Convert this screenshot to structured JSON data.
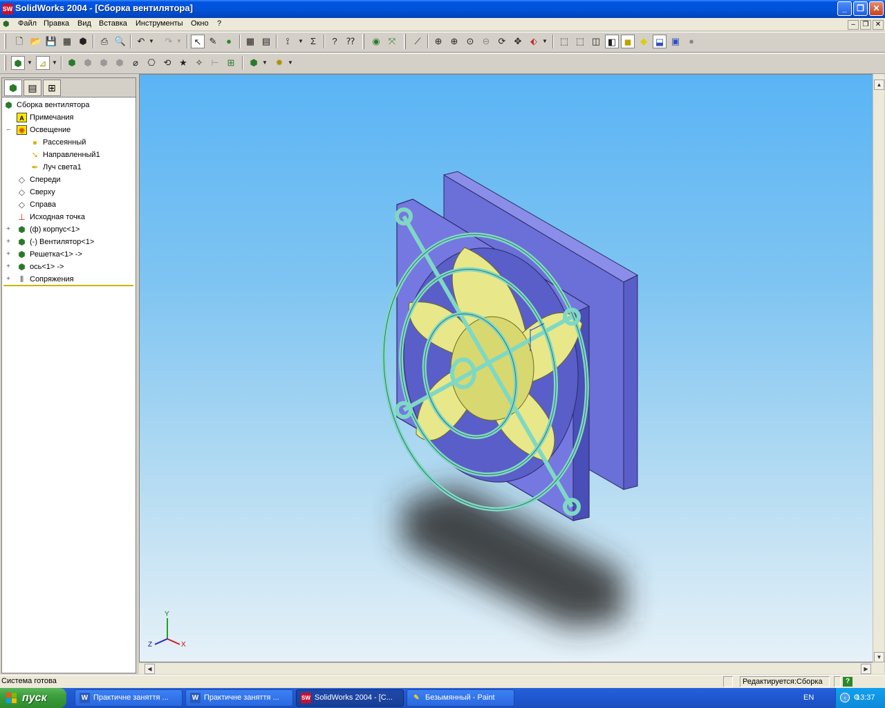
{
  "window": {
    "title": "SolidWorks 2004 - [Сборка вентилятора]",
    "logo": "SW",
    "minimize": "_",
    "restore": "❐",
    "close": "✕"
  },
  "menu": {
    "items": [
      "Файл",
      "Правка",
      "Вид",
      "Вставка",
      "Инструменты",
      "Окно",
      "?"
    ],
    "mdi_minimize": "–",
    "mdi_restore": "❐",
    "mdi_close": "✕"
  },
  "feature_tree": {
    "root": "Сборка вентилятора",
    "items": [
      {
        "label": "Примечания",
        "expander": "",
        "level": 1
      },
      {
        "label": "Освещение",
        "expander": "–",
        "level": 1
      },
      {
        "label": "Рассеянный",
        "expander": "",
        "level": 2
      },
      {
        "label": "Направленный1",
        "expander": "",
        "level": 2
      },
      {
        "label": "Луч света1",
        "expander": "",
        "level": 2
      },
      {
        "label": "Спереди",
        "expander": "",
        "level": 1
      },
      {
        "label": "Сверху",
        "expander": "",
        "level": 1
      },
      {
        "label": "Справа",
        "expander": "",
        "level": 1
      },
      {
        "label": "Исходная точка",
        "expander": "",
        "level": 1
      },
      {
        "label": "(ф) корпус<1>",
        "expander": "+",
        "level": 1
      },
      {
        "label": "(-) Вентилятор<1>",
        "expander": "+",
        "level": 1
      },
      {
        "label": "Решетка<1> ->",
        "expander": "+",
        "level": 1
      },
      {
        "label": "ось<1> ->",
        "expander": "+",
        "level": 1
      },
      {
        "label": "Сопряжения",
        "expander": "+",
        "level": 1
      }
    ]
  },
  "triad": {
    "x": "X",
    "y": "Y",
    "z": "Z"
  },
  "status": {
    "left": "Система готова",
    "mode": "Редактируется:Сборка",
    "help": "?"
  },
  "taskbar": {
    "start": "пуск",
    "buttons": [
      {
        "label": "Практичне заняття ...",
        "icon": "W"
      },
      {
        "label": "Практичне заняття ...",
        "icon": "W"
      },
      {
        "label": "SolidWorks 2004 - [С...",
        "icon": "SW"
      },
      {
        "label": "Безымянный - Paint",
        "icon": "✎"
      }
    ],
    "lang": "EN",
    "time": "13:37"
  },
  "colors": {
    "fan_housing": "#6b6fd8",
    "fan_blades": "#e8e88a",
    "grille": "#7fd8c4",
    "sky_top": "#5ab4f4"
  }
}
